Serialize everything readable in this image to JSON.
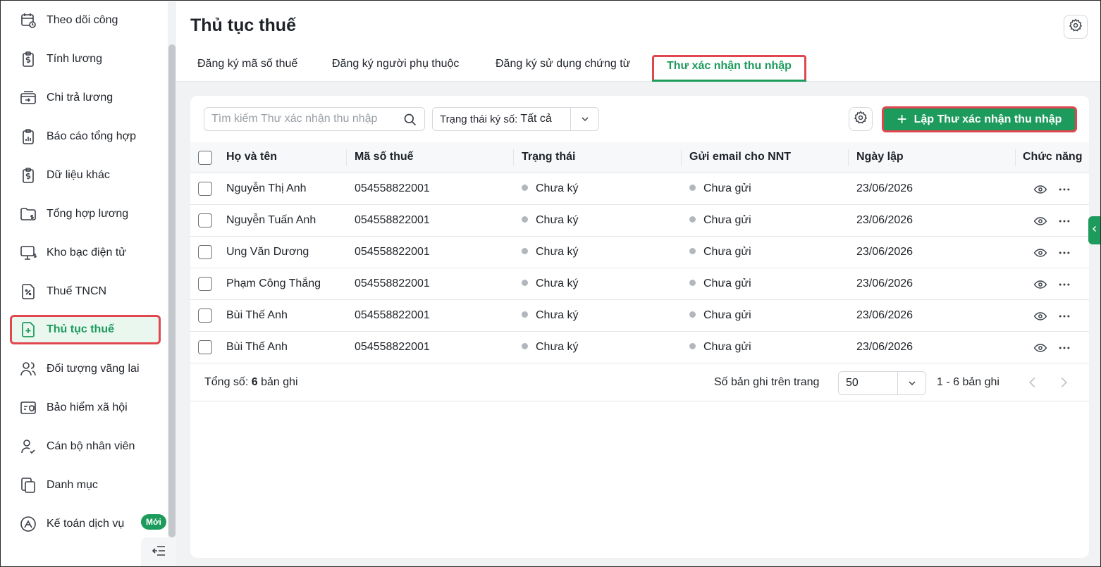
{
  "sidebar": {
    "items": [
      {
        "label": "Theo dõi công",
        "icon": "calendar-clock-icon"
      },
      {
        "label": "Tính lương",
        "icon": "salary-clipboard-icon"
      },
      {
        "label": "Chi trả lương",
        "icon": "wallet-transfer-icon"
      },
      {
        "label": "Báo cáo tổng hợp",
        "icon": "report-clipboard-icon"
      },
      {
        "label": "Dữ liệu khác",
        "icon": "data-clipboard-icon"
      },
      {
        "label": "Tổng hợp lương",
        "icon": "folder-money-icon"
      },
      {
        "label": "Kho bạc điện tử",
        "icon": "monitor-money-icon"
      },
      {
        "label": "Thuế TNCN",
        "icon": "tax-document-icon"
      },
      {
        "label": "Thủ tục thuế",
        "icon": "document-plus-icon",
        "active": true
      },
      {
        "label": "Đối tượng vãng lai",
        "icon": "users-icon"
      },
      {
        "label": "Bảo hiểm xã hội",
        "icon": "insurance-card-icon"
      },
      {
        "label": "Cán bộ nhân viên",
        "icon": "user-check-icon"
      },
      {
        "label": "Danh mục",
        "icon": "copy-documents-icon"
      },
      {
        "label": "Kế toán dịch vụ",
        "icon": "accounting-service-icon"
      }
    ],
    "new_badge": "Mới"
  },
  "header": {
    "title": "Thủ tục thuế",
    "tabs": [
      {
        "label": "Đăng ký mã số thuế"
      },
      {
        "label": "Đăng ký người phụ thuộc"
      },
      {
        "label": "Đăng ký sử dụng chứng từ"
      },
      {
        "label": "Thư xác nhận thu nhập",
        "active": true
      }
    ]
  },
  "toolbar": {
    "search_placeholder": "Tìm kiếm Thư xác nhận thu nhập",
    "filter_label": "Trạng thái ký số:",
    "filter_value": "Tất cả",
    "create_label": "Lập Thư xác nhận thu nhập"
  },
  "table": {
    "columns": [
      "Họ và tên",
      "Mã số thuế",
      "Trạng thái",
      "Gửi email cho NNT",
      "Ngày lập",
      "Chức năng"
    ],
    "rows": [
      {
        "name": "Nguyễn Thị Anh",
        "tax_code": "054558822001",
        "status": "Chưa ký",
        "email": "Chưa gửi",
        "date": "23/06/2026"
      },
      {
        "name": "Nguyễn Tuấn Anh",
        "tax_code": "054558822001",
        "status": "Chưa ký",
        "email": "Chưa gửi",
        "date": "23/06/2026"
      },
      {
        "name": "Ung Văn Dương",
        "tax_code": "054558822001",
        "status": "Chưa ký",
        "email": "Chưa gửi",
        "date": "23/06/2026"
      },
      {
        "name": "Phạm Công Thắng",
        "tax_code": "054558822001",
        "status": "Chưa ký",
        "email": "Chưa gửi",
        "date": "23/06/2026"
      },
      {
        "name": "Bùi Thế Anh",
        "tax_code": "054558822001",
        "status": "Chưa ký",
        "email": "Chưa gửi",
        "date": "23/06/2026"
      },
      {
        "name": "Bùi Thế Anh",
        "tax_code": "054558822001",
        "status": "Chưa ký",
        "email": "Chưa gửi",
        "date": "23/06/2026"
      }
    ]
  },
  "footer": {
    "total_label": "Tổng số:",
    "total_count": "6",
    "total_unit": "bản ghi",
    "per_page_label": "Số bản ghi trên trang",
    "per_page_value": "50",
    "range": "1 - 6 bản ghi"
  },
  "colors": {
    "accent": "#1d9b5c",
    "highlight_border": "#e0464e",
    "status_dot": "#b3b7bd"
  }
}
